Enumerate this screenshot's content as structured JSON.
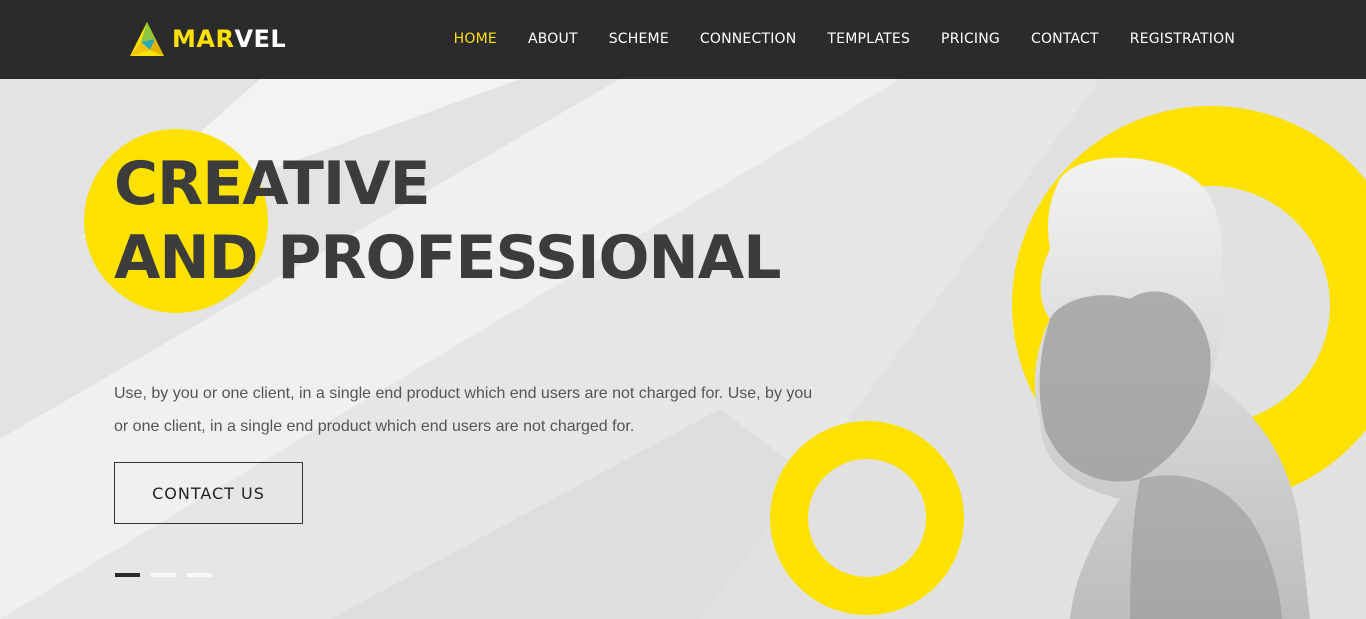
{
  "brand": {
    "name_part1": "MAR",
    "name_part2": "VEL",
    "logo_icon": "star-triangle-icon"
  },
  "nav": {
    "items": [
      {
        "label": "HOME",
        "active": true
      },
      {
        "label": "ABOUT",
        "active": false
      },
      {
        "label": "SCHEME",
        "active": false
      },
      {
        "label": "CONNECTION",
        "active": false
      },
      {
        "label": "TEMPLATES",
        "active": false
      },
      {
        "label": "PRICING",
        "active": false
      },
      {
        "label": "CONTACT",
        "active": false
      },
      {
        "label": "REGISTRATION",
        "active": false
      }
    ]
  },
  "hero": {
    "headline_line1": "CREATIVE",
    "headline_line2": "AND PROFESSIONAL",
    "description_line1": "Use, by you or one client, in a single end product which end users are not charged for. Use, by you",
    "description_line2": "or one client, in a single end product which end users are not charged for.",
    "cta_label": "CONTACT US",
    "slider": {
      "slide_count": 3,
      "active_index": 0
    }
  },
  "colors": {
    "accent": "#fde100",
    "header_bg": "#2b2b2b",
    "text_dark": "#3c3c3c"
  }
}
